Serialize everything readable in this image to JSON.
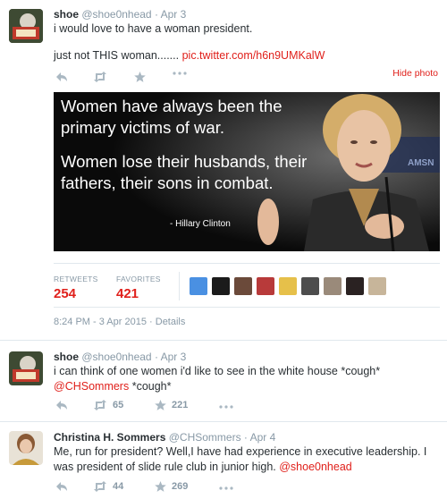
{
  "tweets": [
    {
      "name": "shoe",
      "handle": "@shoe0nhead",
      "date": "Apr 3",
      "line1": "i would love to have a woman president.",
      "line2_prefix": "just not THIS woman.......",
      "line2_link": "pic.twitter.com/h6n9UMKalW"
    },
    {
      "name": "shoe",
      "handle": "@shoe0nhead",
      "date": "Apr 3",
      "line1": "i can think of one women i'd like to see in the white house *cough*",
      "line2_link": "@CHSommers",
      "line2_suffix": " *cough*",
      "retweets": "65",
      "favorites": "221"
    },
    {
      "name": "Christina H. Sommers",
      "handle": "@CHSommers",
      "date": "Apr 4",
      "line1": "Me, run for president? Well,I have had experience in executive leadership. I",
      "line2_prefix": "was president of slide rule club in junior high.",
      "line2_link": "@shoe0nhead",
      "retweets": "44",
      "favorites": "269"
    }
  ],
  "hide_photo": "Hide photo",
  "photo": {
    "quote1": "Women have always been the",
    "quote2": "primary victims of war.",
    "quote3": "Women lose their husbands, their",
    "quote4": "fathers, their sons in combat.",
    "credit": "- Hillary Clinton",
    "bg_text": "AMSN"
  },
  "stats": {
    "retweets_label": "RETWEETS",
    "retweets_value": "254",
    "favorites_label": "FAVORITES",
    "favorites_value": "421"
  },
  "meta": {
    "timestamp": "8:24 PM - 3 Apr 2015",
    "details": "Details"
  },
  "colors": {
    "accent": "#e0201b",
    "muted": "#8899a6",
    "border": "#e1e8ed"
  }
}
